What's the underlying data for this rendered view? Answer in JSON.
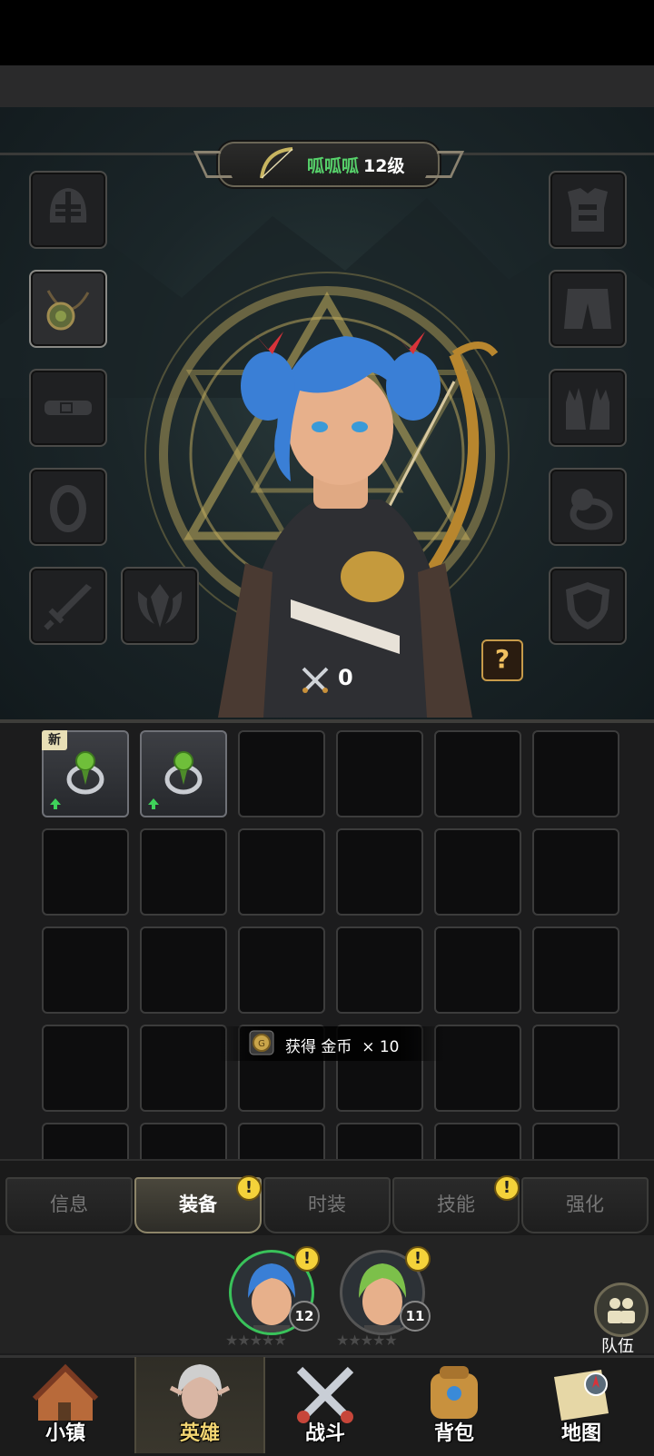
{
  "hero": {
    "name": "呱呱呱",
    "level": "12级",
    "power": "0"
  },
  "equipment_slots": [
    {
      "id": "helmet",
      "side": "left",
      "filled": false
    },
    {
      "id": "necklace",
      "side": "left",
      "filled": true
    },
    {
      "id": "belt",
      "side": "left",
      "filled": false
    },
    {
      "id": "ring",
      "side": "left",
      "filled": false
    },
    {
      "id": "weapon",
      "side": "left",
      "filled": false
    },
    {
      "id": "offhand",
      "side": "left",
      "filled": false
    },
    {
      "id": "armor",
      "side": "right",
      "filled": false
    },
    {
      "id": "pants",
      "side": "right",
      "filled": false
    },
    {
      "id": "gloves",
      "side": "right",
      "filled": false
    },
    {
      "id": "ring",
      "side": "right",
      "filled": false
    },
    {
      "id": "shield",
      "side": "right",
      "filled": false
    }
  ],
  "help_button": "?",
  "inventory": {
    "items": [
      {
        "type": "green-gem-ring",
        "badge": "新",
        "upgrade": true
      },
      {
        "type": "green-gem-ring",
        "badge": "",
        "upgrade": true
      }
    ]
  },
  "toast": {
    "text": "获得 金币  × 10"
  },
  "tabs": [
    {
      "label": "信息",
      "active": false,
      "alert": false
    },
    {
      "label": "装备",
      "active": true,
      "alert": true
    },
    {
      "label": "时装",
      "active": false,
      "alert": false
    },
    {
      "label": "技能",
      "active": false,
      "alert": true
    },
    {
      "label": "强化",
      "active": false,
      "alert": false
    }
  ],
  "roster": [
    {
      "level": "12",
      "selected": true,
      "alert": true
    },
    {
      "level": "11",
      "selected": false,
      "alert": true
    }
  ],
  "team_button": "队伍",
  "nav": [
    {
      "label": "小镇",
      "active": false
    },
    {
      "label": "英雄",
      "active": true
    },
    {
      "label": "战斗",
      "active": false
    },
    {
      "label": "背包",
      "active": false
    },
    {
      "label": "地图",
      "active": false
    }
  ],
  "colors": {
    "name_green": "#56d06a",
    "alert_yellow": "#f4d23a",
    "selected_ring": "#39c25a",
    "nav_active": "#f3d572"
  }
}
